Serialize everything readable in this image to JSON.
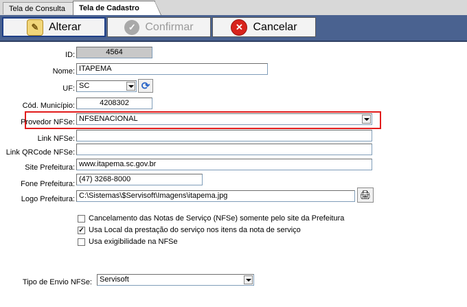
{
  "tabs": {
    "consulta": "Tela de Consulta",
    "cadastro": "Tela de Cadastro"
  },
  "toolbar": {
    "alterar": "Alterar",
    "confirmar": "Confirmar",
    "cancelar": "Cancelar"
  },
  "form": {
    "id": {
      "label": "ID:",
      "value": "4564"
    },
    "nome": {
      "label": "Nome:",
      "value": "ITAPEMA"
    },
    "uf": {
      "label": "UF:",
      "value": "SC"
    },
    "cod_municipio": {
      "label": "Cód. Município:",
      "value": "4208302"
    },
    "provedor_nfse": {
      "label": "Provedor NFSe:",
      "value": "NFSENACIONAL"
    },
    "link_nfse": {
      "label": "Link NFSe:",
      "value": ""
    },
    "link_qrcode": {
      "label": "Link QRCode NFSe:",
      "value": ""
    },
    "site_prefeitura": {
      "label": "Site Prefeitura:",
      "value": "www.itapema.sc.gov.br"
    },
    "fone_prefeitura": {
      "label": "Fone Prefeitura:",
      "value": "(47) 3268-8000"
    },
    "logo_prefeitura": {
      "label": "Logo Prefeitura:",
      "value": "C:\\Sistemas\\$Servisoft\\Imagens\\itapema.jpg"
    },
    "tipo_envio": {
      "label": "Tipo de Envio NFSe:",
      "value": "Servisoft"
    }
  },
  "options": [
    {
      "label": "Cancelamento das Notas de Serviço (NFSe) somente pelo site da Prefeitura",
      "checked": false
    },
    {
      "label": "Usa Local da prestação do serviço nos itens da nota de serviço",
      "checked": true
    },
    {
      "label": "Usa exigibilidade na NFSe",
      "checked": false
    }
  ],
  "icons": {
    "alterar": "pencil-icon",
    "confirmar": "check-icon",
    "cancelar": "cancel-icon",
    "refresh": "refresh-icon",
    "logo": "printer-icon"
  },
  "colors": {
    "toolbar": "#4a6290",
    "highlight": "#e11b1b",
    "cancel": "#d8231c"
  }
}
